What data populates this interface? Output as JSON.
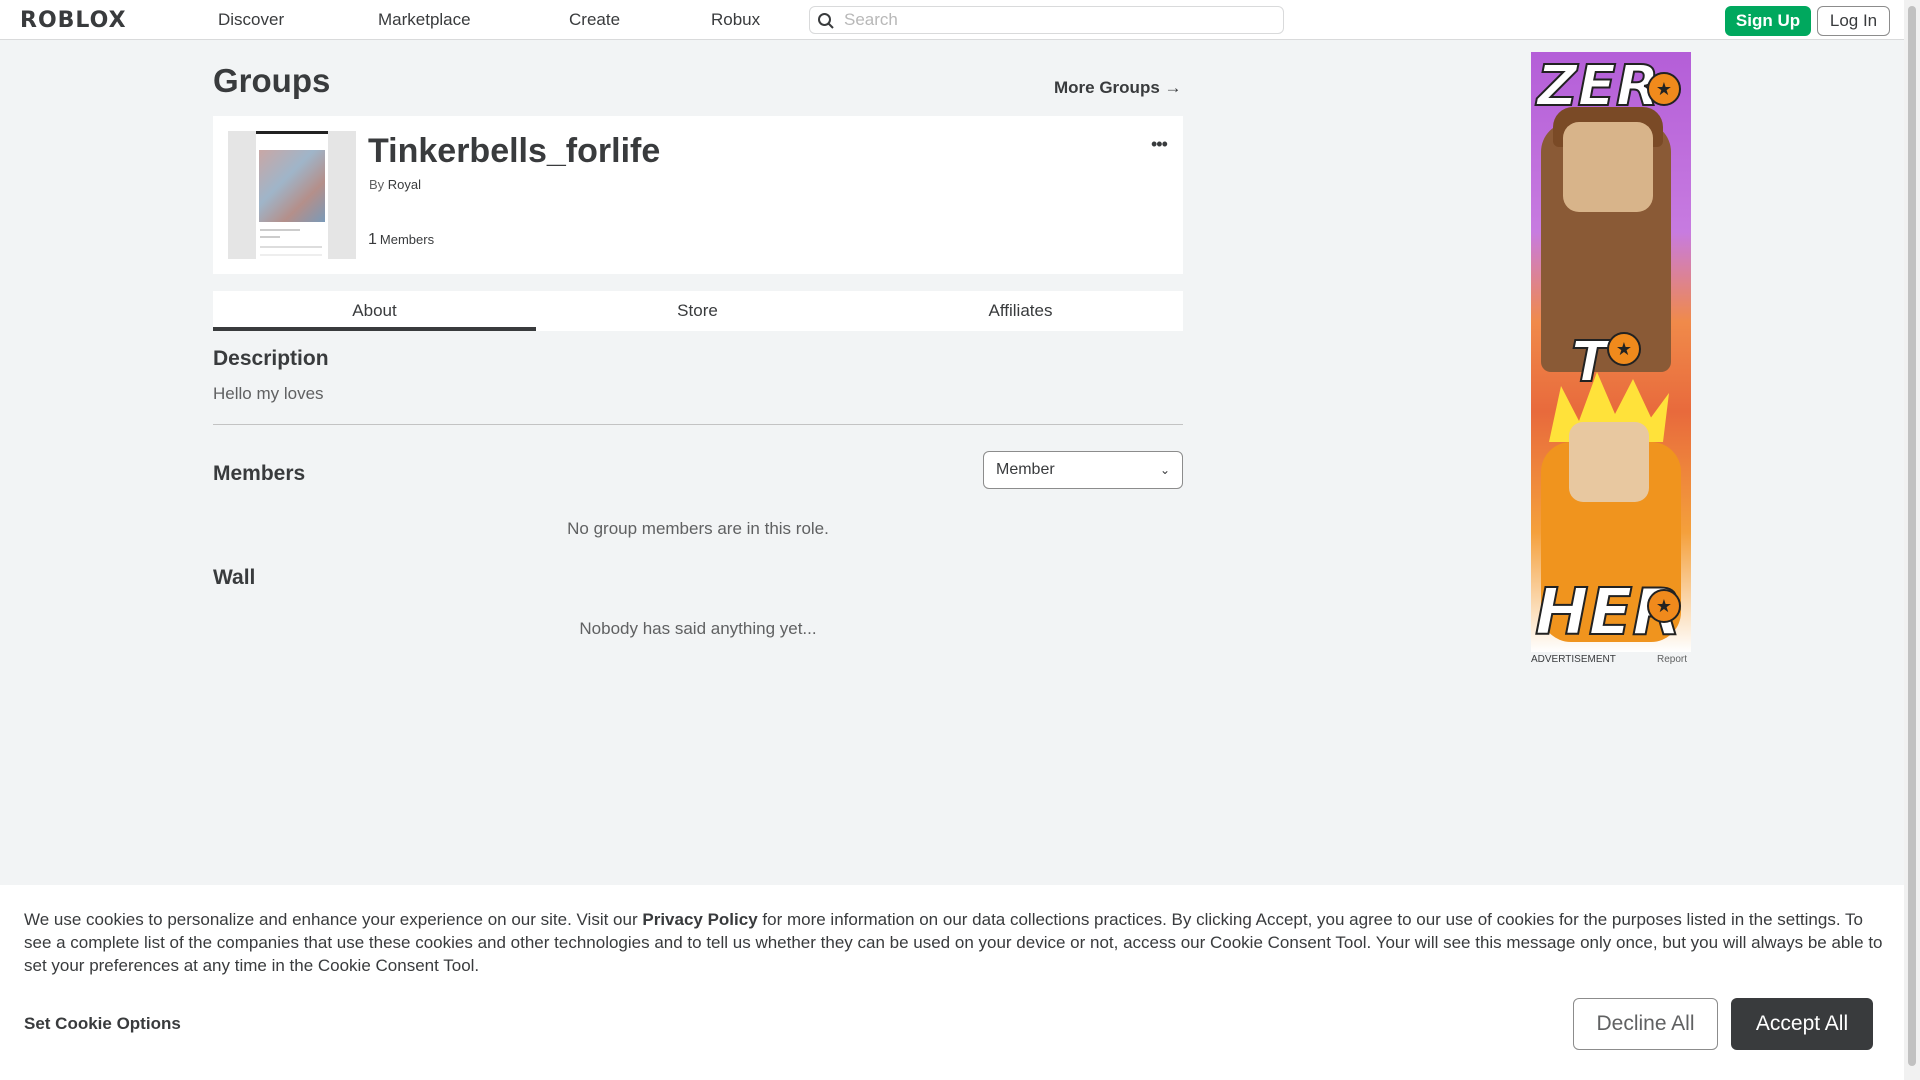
{
  "nav": {
    "logo": "ROBLOX",
    "links": [
      "Discover",
      "Marketplace",
      "Create",
      "Robux"
    ],
    "search_placeholder": "Search",
    "signup": "Sign Up",
    "login": "Log In"
  },
  "page": {
    "title": "Groups",
    "more_groups": "More Groups →"
  },
  "group": {
    "name": "Tinkerbells_forlife",
    "by_prefix": "By",
    "owner": "Royal",
    "member_count": "1",
    "member_label": "Members",
    "menu_glyph": "•••"
  },
  "tabs": [
    "About",
    "Store",
    "Affiliates"
  ],
  "about": {
    "description_title": "Description",
    "description_text": "Hello my loves",
    "members_title": "Members",
    "role_selected": "Member",
    "members_empty": "No group members are in this role.",
    "wall_title": "Wall",
    "wall_empty": "Nobody has said anything yet..."
  },
  "ad": {
    "words": [
      "ZER",
      "T",
      "HER"
    ],
    "label": "ADVERTISEMENT",
    "report": "Report"
  },
  "cookie": {
    "text_before": "We use cookies to personalize and enhance your experience on our site. Visit our ",
    "link": "Privacy Policy",
    "text_after": " for more information on our data collections practices. By clicking Accept, you agree to our use of cookies for the purposes listed in the settings. To see a complete list of the companies that use these cookies and other technologies and to tell us whether they can be used on your device or not, access our Cookie Consent Tool. Your will see this message only once, but you will always be able to set your preferences at any time in the Cookie Consent Tool.",
    "options": "Set Cookie Options",
    "decline": "Decline All",
    "accept": "Accept All"
  },
  "colors": {
    "accent_green": "#00a85e",
    "text_dark": "#393b3d",
    "background": "#f2f4f5"
  }
}
